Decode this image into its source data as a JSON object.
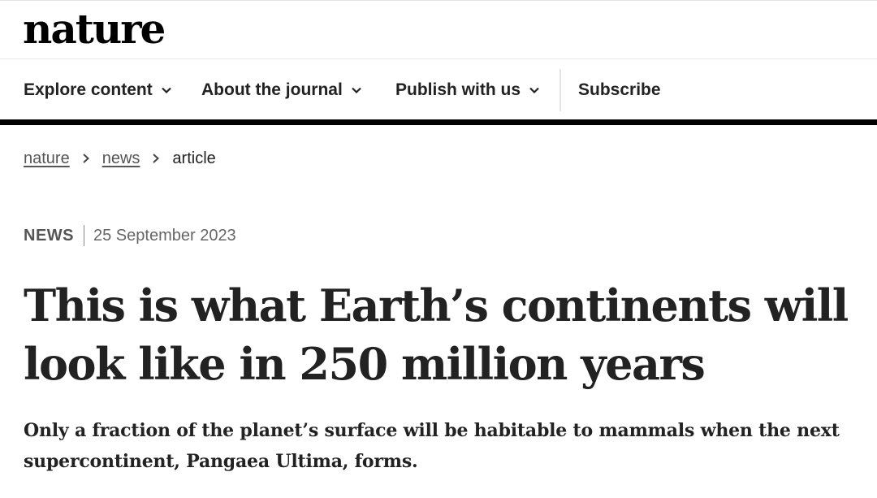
{
  "site": {
    "logo": "nature"
  },
  "nav": {
    "items": [
      {
        "label": "Explore content",
        "has_dropdown": true,
        "icon": "chevron-down-icon"
      },
      {
        "label": "About the journal",
        "has_dropdown": true,
        "icon": "chevron-down-icon"
      },
      {
        "label": "Publish with us",
        "has_dropdown": true,
        "icon": "chevron-down-icon"
      },
      {
        "label": "Subscribe",
        "has_dropdown": false
      }
    ]
  },
  "breadcrumb": {
    "items": [
      {
        "label": "nature",
        "is_link": true
      },
      {
        "label": "news",
        "is_link": true
      },
      {
        "label": "article",
        "is_link": false
      }
    ],
    "separator_icon": "chevron-right-icon"
  },
  "article": {
    "type": "NEWS",
    "date": "25 September 2023",
    "title": "This is what Earth’s continents will look like in 250 million years",
    "standfirst": "Only a fraction of the planet’s surface will be habitable to mammals when the next supercontinent, Pangaea Ultima, forms."
  },
  "colors": {
    "text": "#222222",
    "muted": "#555555",
    "rule": "#000000",
    "background": "#ffffff"
  }
}
